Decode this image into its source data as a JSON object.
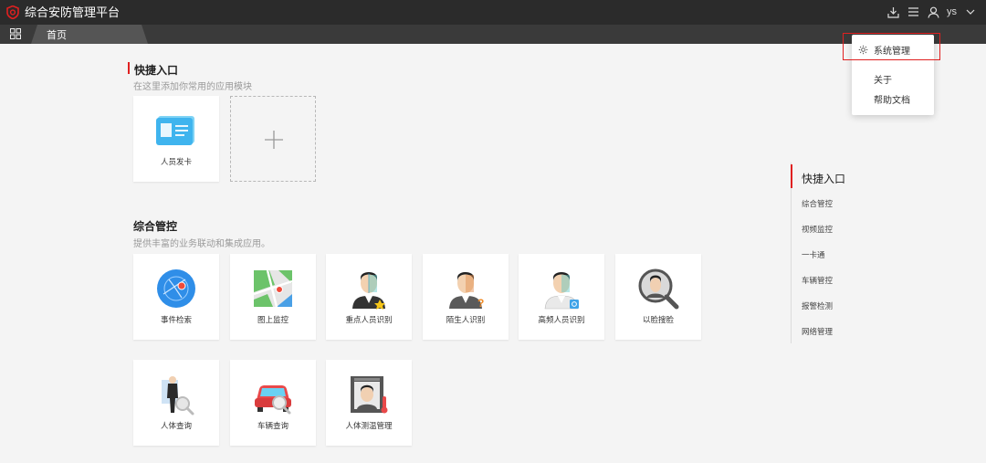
{
  "app": {
    "title": "综合安防管理平台",
    "username": "ys"
  },
  "tabs": {
    "home": "首页"
  },
  "quick": {
    "title": "快捷入口",
    "subtitle": "在这里添加你常用的应用模块",
    "items": [
      {
        "label": "人员发卡",
        "icon": "id-card-icon"
      }
    ]
  },
  "integrated": {
    "title": "综合管控",
    "subtitle": "提供丰富的业务联动和集成应用。",
    "items": [
      {
        "label": "事件检索",
        "icon": "event-search-icon"
      },
      {
        "label": "图上监控",
        "icon": "map-monitor-icon"
      },
      {
        "label": "重点人员识别",
        "icon": "key-person-icon"
      },
      {
        "label": "陌生人识别",
        "icon": "stranger-icon"
      },
      {
        "label": "高频人员识别",
        "icon": "frequent-person-icon"
      },
      {
        "label": "以脸搜脸",
        "icon": "face-search-icon"
      },
      {
        "label": "人体查询",
        "icon": "body-search-icon"
      },
      {
        "label": "车辆查询",
        "icon": "vehicle-search-icon"
      },
      {
        "label": "人体测温管理",
        "icon": "temperature-icon"
      }
    ]
  },
  "side_nav": [
    "快捷入口",
    "综合管控",
    "视频监控",
    "一卡通",
    "车辆管控",
    "报警检测",
    "网络管理"
  ],
  "dropdown": {
    "items": [
      "系统管理",
      "关于",
      "帮助文档"
    ]
  },
  "colors": {
    "accent": "#e02020",
    "topbar": "#2b2b2b",
    "tabbar": "#3a3a3a"
  }
}
